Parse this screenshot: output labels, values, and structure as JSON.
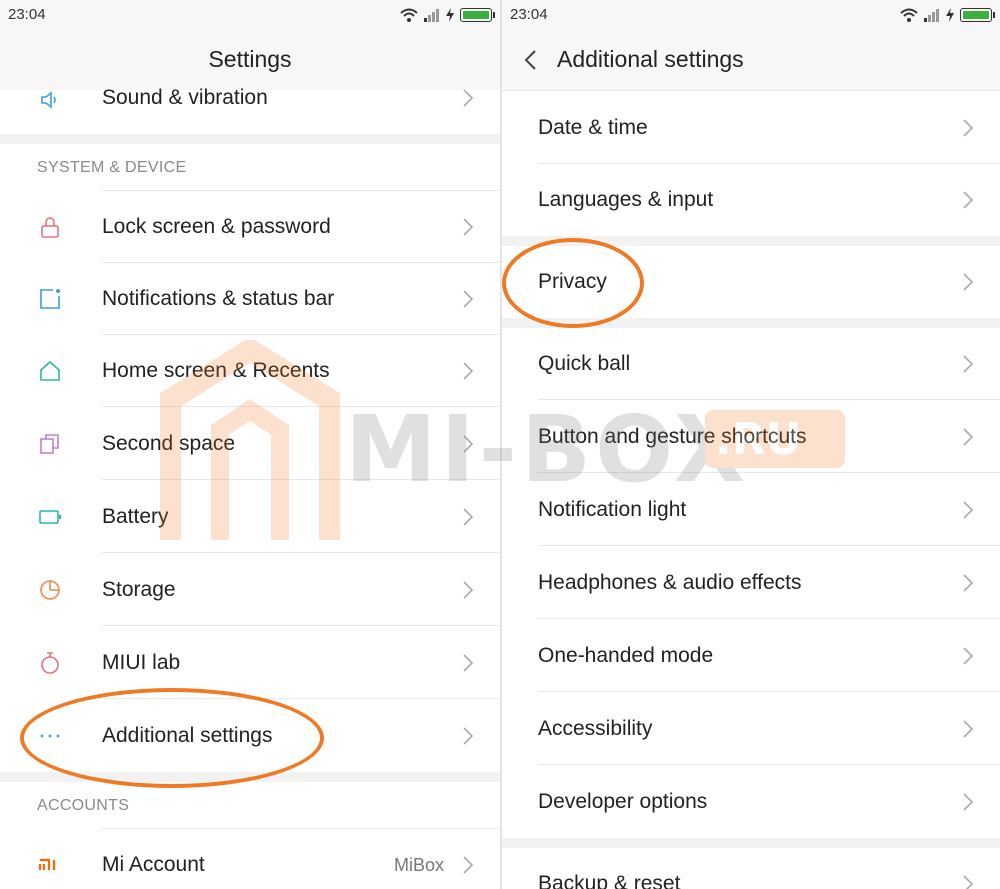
{
  "left_panel": {
    "status_time": "23:04",
    "title": "Settings",
    "top_item": {
      "label": "Sound & vibration"
    },
    "section_system": "SYSTEM & DEVICE",
    "items": [
      {
        "label": "Lock screen & password",
        "icon": "lock-icon"
      },
      {
        "label": "Notifications & status bar",
        "icon": "notification-icon"
      },
      {
        "label": "Home screen & Recents",
        "icon": "home-icon"
      },
      {
        "label": "Second space",
        "icon": "second-space-icon"
      },
      {
        "label": "Battery",
        "icon": "battery-icon"
      },
      {
        "label": "Storage",
        "icon": "storage-icon"
      },
      {
        "label": "MIUI lab",
        "icon": "lab-flask-icon"
      },
      {
        "label": "Additional settings",
        "icon": "more-dots-icon"
      }
    ],
    "section_accounts": "ACCOUNTS",
    "account_item": {
      "label": "Mi Account",
      "value": "MiBox",
      "icon": "mi-logo-icon"
    }
  },
  "right_panel": {
    "status_time": "23:04",
    "title": "Additional  settings",
    "items": [
      {
        "label": "Date & time"
      },
      {
        "label": "Languages & input"
      },
      {
        "label": "Privacy"
      },
      {
        "label": "Quick ball"
      },
      {
        "label": "Button and gesture shortcuts"
      },
      {
        "label": "Notification light"
      },
      {
        "label": "Headphones & audio effects"
      },
      {
        "label": "One-handed mode"
      },
      {
        "label": "Accessibility"
      },
      {
        "label": "Developer options"
      },
      {
        "label": "Backup & reset"
      }
    ]
  },
  "watermark": {
    "text": "MI-BOX",
    "badge": ".RU"
  },
  "colors": {
    "highlight": "#f07a24",
    "battery_fill": "#3cb03c",
    "icon_red": "#e5737d",
    "icon_blue": "#3aa0e0",
    "icon_teal": "#2ab8a8",
    "icon_purple": "#c77fd6",
    "icon_orange": "#f08a4a",
    "mi_orange": "#ff6700"
  }
}
